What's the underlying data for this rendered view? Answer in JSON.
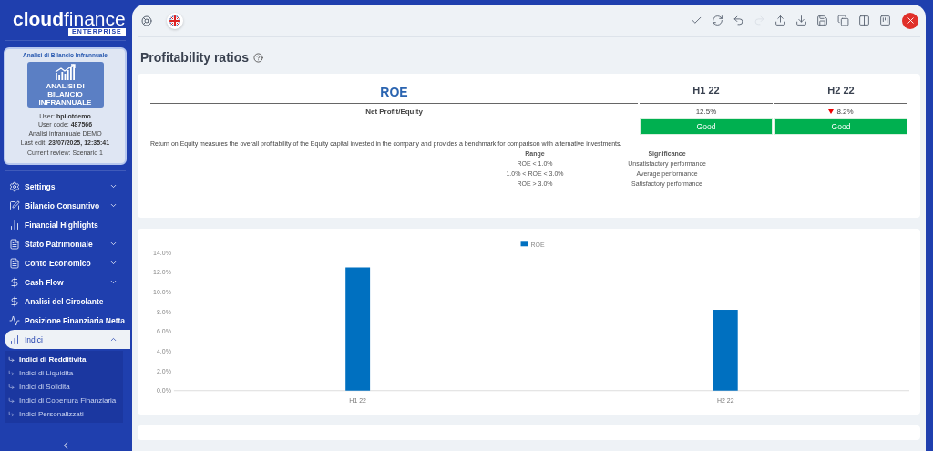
{
  "brand": {
    "name_bold": "cloud",
    "name_light": "finance",
    "edition": "ENTERPRISE"
  },
  "profile": {
    "title": "Analisi di Bilancio Infrannuale",
    "badge_text": "ANALISI DI BILANCIO INFRANNUALE",
    "user_label": "User:",
    "user": "bpilotdemo",
    "code_label": "User code:",
    "code": "487566",
    "analysis": "Analisi infrannuale DEMO",
    "edit_label": "Last edit:",
    "edit": "23/07/2025, 12:35:41",
    "review": "Current review: Scenario 1"
  },
  "sidebar": {
    "items": [
      {
        "label": "Settings",
        "kind": "group",
        "expanded": false,
        "selected": false
      },
      {
        "label": "Bilancio Consuntivo",
        "kind": "group",
        "expanded": false,
        "selected": false
      },
      {
        "label": "Financial Highlights",
        "kind": "link",
        "selected": false
      },
      {
        "label": "Stato Patrimoniale",
        "kind": "group",
        "expanded": false,
        "selected": false
      },
      {
        "label": "Conto Economico",
        "kind": "group",
        "expanded": false,
        "selected": false
      },
      {
        "label": "Cash Flow",
        "kind": "group",
        "expanded": false,
        "selected": false
      },
      {
        "label": "Analisi del Circolante",
        "kind": "link",
        "selected": false
      },
      {
        "label": "Posizione Finanziaria Netta",
        "kind": "link",
        "selected": false
      },
      {
        "label": "Indici",
        "kind": "group",
        "expanded": true,
        "selected": true,
        "children": [
          {
            "label": "Indici di Redditivita",
            "selected": true
          },
          {
            "label": "Indici di Liquidita",
            "selected": false
          },
          {
            "label": "Indici di Solidita",
            "selected": false
          },
          {
            "label": "Indici di Copertura Finanziaria",
            "selected": false
          },
          {
            "label": "Indici Personalizzati",
            "selected": false
          }
        ]
      }
    ]
  },
  "toolbar": {
    "buttons": [
      {
        "disabled": false
      },
      {
        "disabled": false
      },
      {
        "disabled": false
      },
      {
        "disabled": true
      },
      {
        "disabled": false
      },
      {
        "disabled": false
      },
      {
        "disabled": false
      },
      {
        "disabled": false
      },
      {
        "disabled": false
      },
      {
        "disabled": false
      }
    ]
  },
  "page": {
    "title": "Profitability ratios"
  },
  "ratio_card": {
    "title": "ROE",
    "columns": [
      "H1 22",
      "H2 22"
    ],
    "formula": "Net Profit/Equity",
    "values": [
      {
        "text": "12.5%",
        "down": false
      },
      {
        "text": "8.2%",
        "down": true
      }
    ],
    "ratings": [
      {
        "label": "Good",
        "color": "#00b050"
      },
      {
        "label": "Good",
        "color": "#00b050"
      }
    ],
    "description": "Return on Equity measures the overall profitability of the Equity capital invested in the company and provides a benchmark for comparison with alternative investments.",
    "range_table": {
      "columns": [
        "Range",
        "Significance"
      ],
      "rows": [
        [
          "ROE < 1.0%",
          "Unsatisfactory performance"
        ],
        [
          "1.0% < ROE < 3.0%",
          "Average performance"
        ],
        [
          "ROE > 3.0%",
          "Satisfactory performance"
        ]
      ]
    }
  },
  "chart_card": {
    "chart_data": {
      "type": "bar",
      "categories": [
        "H1 22",
        "H2 22"
      ],
      "series": [
        {
          "name": "ROE",
          "color": "#0070c0",
          "values": [
            12.5,
            8.2
          ]
        }
      ],
      "ylim": [
        0,
        14
      ],
      "yticks": [
        {
          "value": 0,
          "label": "0.0%"
        },
        {
          "value": 2,
          "label": "2.0%"
        },
        {
          "value": 4,
          "label": "4.0%"
        },
        {
          "value": 6,
          "label": "6.0%"
        },
        {
          "value": 8,
          "label": "8.0%"
        },
        {
          "value": 10,
          "label": "10.0%"
        },
        {
          "value": 12,
          "label": "12.0%"
        },
        {
          "value": 14,
          "label": "14.0%"
        }
      ]
    }
  }
}
